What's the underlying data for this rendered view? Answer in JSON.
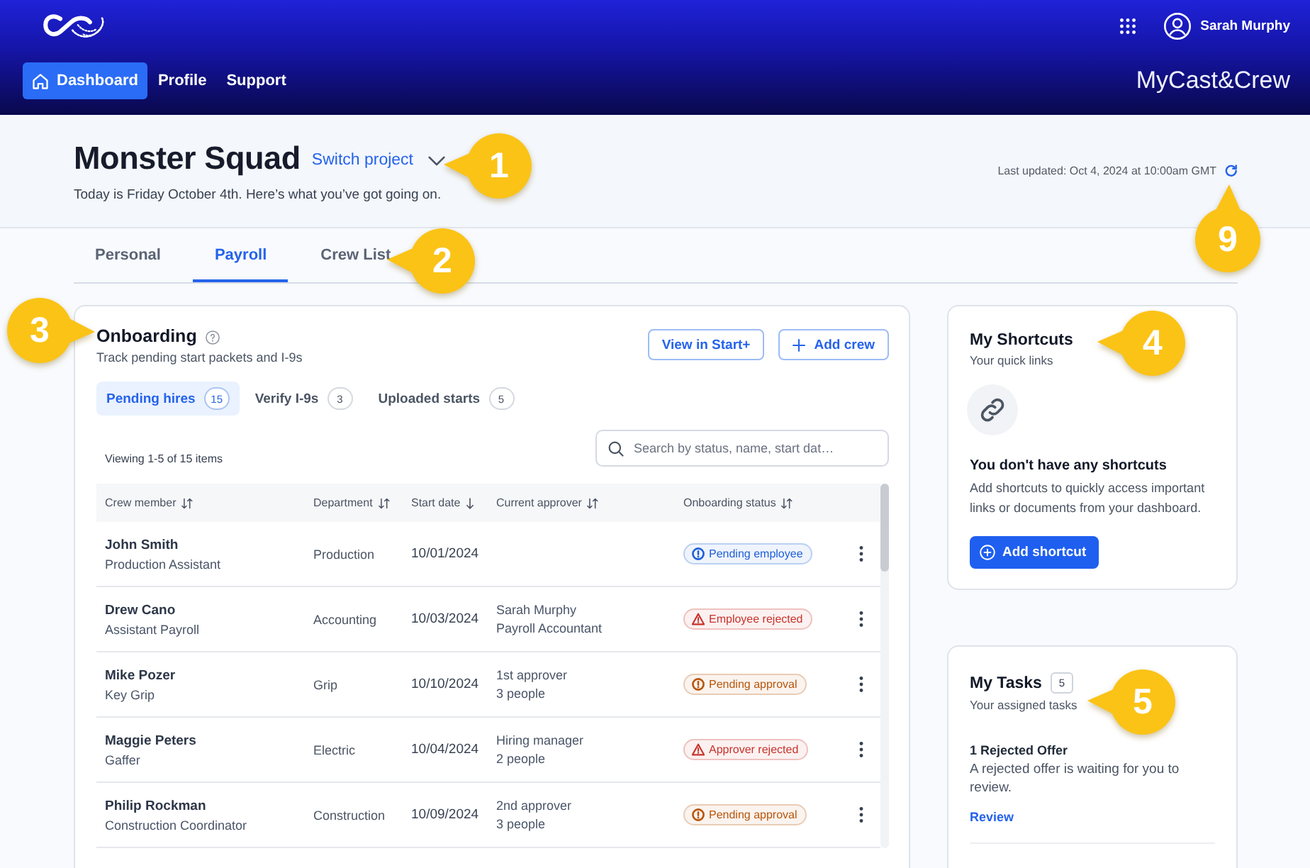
{
  "header": {
    "user_name": "Sarah Murphy",
    "nav": [
      {
        "label": "Dashboard",
        "kind": "home",
        "selected": true
      },
      {
        "label": "Profile",
        "kind": "link",
        "selected": false
      },
      {
        "label": "Support",
        "kind": "link",
        "selected": false
      }
    ],
    "brand": "MyCast&Crew"
  },
  "project": {
    "title": "Monster Squad",
    "switch_label": "Switch project",
    "subtitle": "Today is Friday October 4th. Here’s what you’ve got going on.",
    "last_updated": "Last updated: Oct 4, 2024 at 10:00am GMT",
    "callout": "1",
    "refresh_callout": "9"
  },
  "tabs": {
    "items": [
      {
        "label": "Personal",
        "selected": false
      },
      {
        "label": "Payroll",
        "selected": true
      },
      {
        "label": "Crew List",
        "selected": false
      }
    ],
    "callout": "2"
  },
  "onboarding": {
    "title": "Onboarding",
    "subtitle": "Track pending start packets and I-9s",
    "callout": "3",
    "buttons": [
      {
        "label": "View in Start+",
        "kind": "plain"
      },
      {
        "label": "Add crew",
        "kind": "add"
      }
    ],
    "filters": [
      {
        "label": "Pending hires",
        "count": "15",
        "selected": true
      },
      {
        "label": "Verify I-9s",
        "count": "3",
        "selected": false
      },
      {
        "label": "Uploaded starts",
        "count": "5",
        "selected": false
      }
    ],
    "search": {
      "placeholder": "Search by status, name, start dat…"
    },
    "viewing": "Viewing 1-5 of 15 items",
    "table": {
      "columns": [
        {
          "label": "Crew member",
          "sorted": false
        },
        {
          "label": "Department",
          "sorted": false
        },
        {
          "label": "Start date",
          "sorted": true
        },
        {
          "label": "Current approver",
          "sorted": false
        },
        {
          "label": "Onboarding status",
          "sorted": false
        }
      ],
      "rows": [
        {
          "name": "John Smith",
          "role": "Production Assistant",
          "department": "Production",
          "start_date": "10/01/2024",
          "status": {
            "label": "Pending employee",
            "kind": "info",
            "color": "#1e5fd8"
          }
        },
        {
          "name": "Drew Cano",
          "role": "Assistant Payroll",
          "department": "Accounting",
          "start_date": "10/03/2024",
          "approver": [
            "Sarah Murphy",
            "Payroll Accountant"
          ],
          "status": {
            "label": "Employee rejected",
            "kind": "warning",
            "color": "#c8322b"
          }
        },
        {
          "name": "Mike Pozer",
          "role": "Key Grip",
          "department": "Grip",
          "start_date": "10/10/2024",
          "approver": [
            "1st approver",
            "3 people"
          ],
          "status": {
            "label": "Pending approval",
            "kind": "info",
            "color": "#b8560a"
          }
        },
        {
          "name": "Maggie Peters",
          "role": "Gaffer",
          "department": "Electric",
          "start_date": "10/04/2024",
          "approver": [
            "Hiring manager",
            "2 people"
          ],
          "status": {
            "label": "Approver rejected",
            "kind": "warning",
            "color": "#c8322b"
          }
        },
        {
          "name": "Philip Rockman",
          "role": "Construction Coordinator",
          "department": "Construction",
          "start_date": "10/09/2024",
          "approver": [
            "2nd approver",
            "3 people"
          ],
          "status": {
            "label": "Pending approval",
            "kind": "info",
            "color": "#b8560a"
          }
        }
      ]
    }
  },
  "shortcuts": {
    "title": "My Shortcuts",
    "subtitle": "Your quick links",
    "callout": "4",
    "empty_title": "You don't have any shortcuts",
    "empty_text": "Add shortcuts to quickly access important links or documents from your dashboard.",
    "button": "Add shortcut"
  },
  "tasks": {
    "title": "My Tasks",
    "count": "5",
    "subtitle": "Your assigned tasks",
    "callout": "5",
    "items": [
      {
        "title": "1 Rejected Offer",
        "text": "A rejected offer is waiting for you to review.",
        "link": "Review"
      }
    ]
  }
}
